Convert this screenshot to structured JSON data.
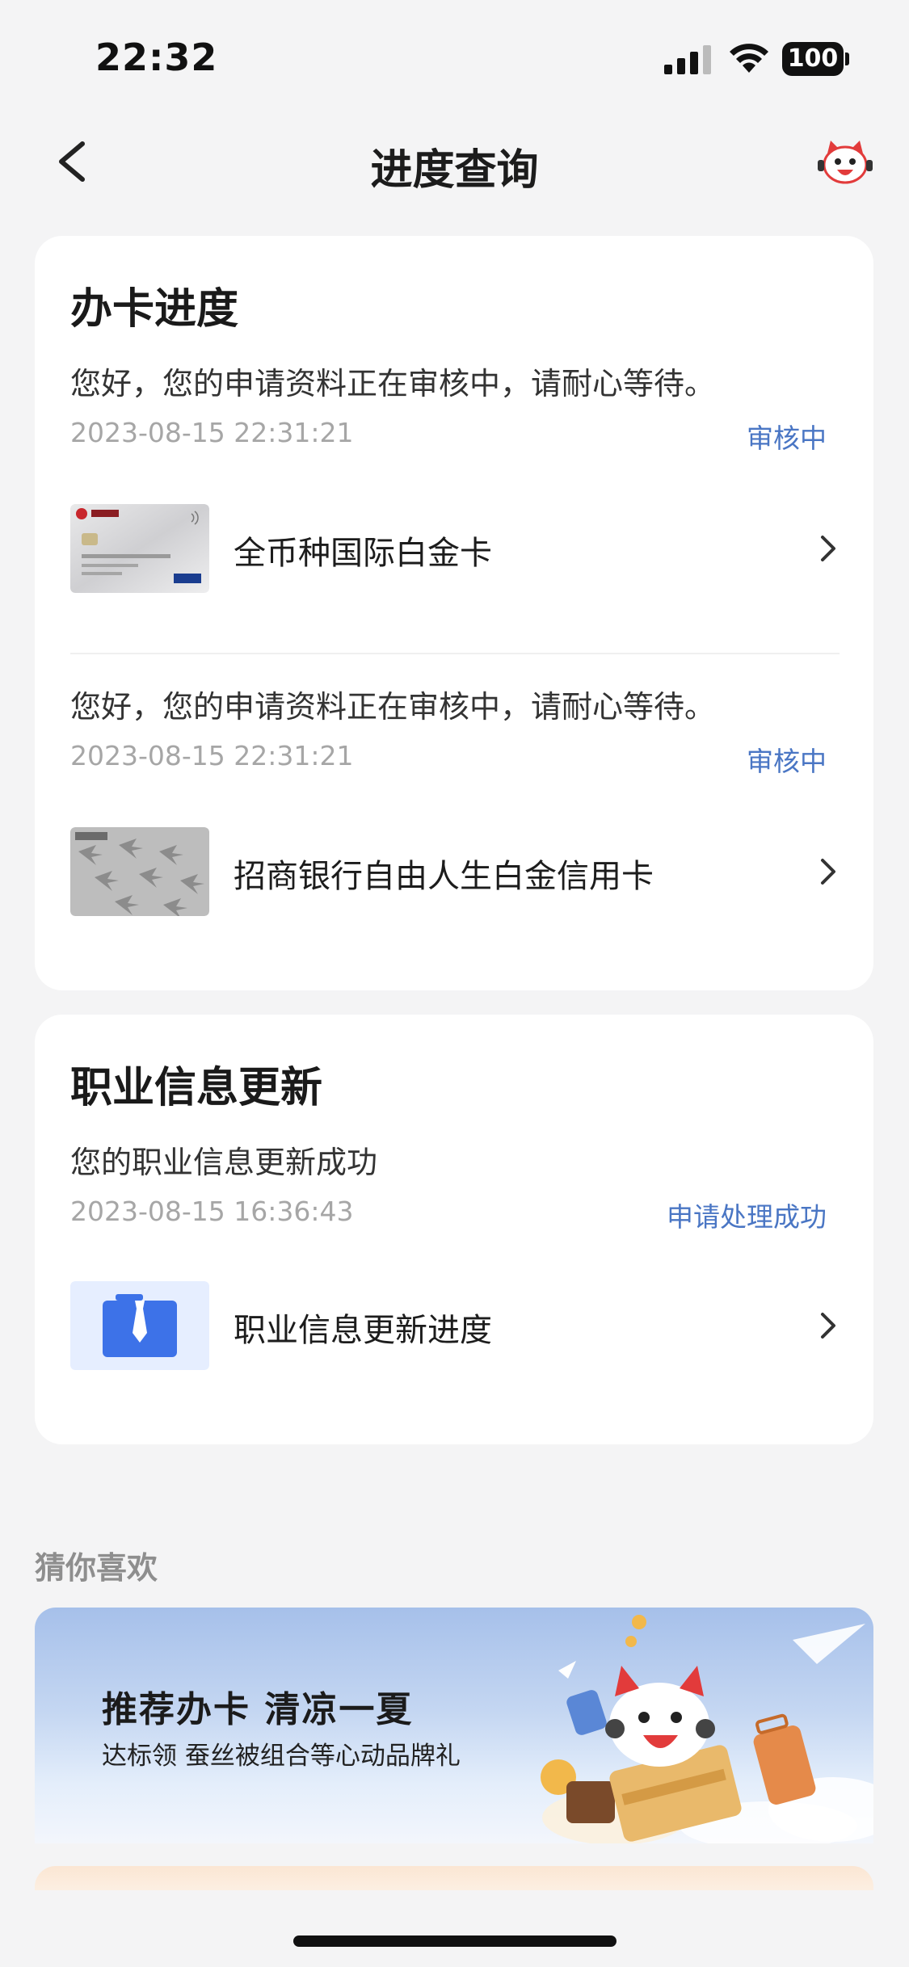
{
  "status_bar": {
    "time": "22:32",
    "battery": "100"
  },
  "nav": {
    "title": "进度查询"
  },
  "card_progress": {
    "title": "办卡进度",
    "entries": [
      {
        "message": "您好，您的申请资料正在审核中，请耐心等待。",
        "time": "2023-08-15 22:31:21",
        "status": "审核中",
        "item": "全币种国际白金卡"
      },
      {
        "message": "您好，您的申请资料正在审核中，请耐心等待。",
        "time": "2023-08-15 22:31:21",
        "status": "审核中",
        "item": "招商银行自由人生白金信用卡"
      }
    ]
  },
  "card_job": {
    "title": "职业信息更新",
    "message": "您的职业信息更新成功",
    "time": "2023-08-15 16:36:43",
    "status": "申请处理成功",
    "item": "职业信息更新进度"
  },
  "recommend": {
    "label": "猜你喜欢",
    "banner_title": "推荐办卡 清凉一夏",
    "banner_subtitle": "达标领 蚕丝被组合等心动品牌礼"
  },
  "colors": {
    "accent": "#4a76c4",
    "background": "#f4f4f5",
    "card": "#ffffff"
  },
  "icons": [
    "back-arrow-icon",
    "mascot-icon",
    "chevron-right-icon",
    "briefcase-icon",
    "signal-icon",
    "wifi-icon",
    "battery-icon"
  ]
}
